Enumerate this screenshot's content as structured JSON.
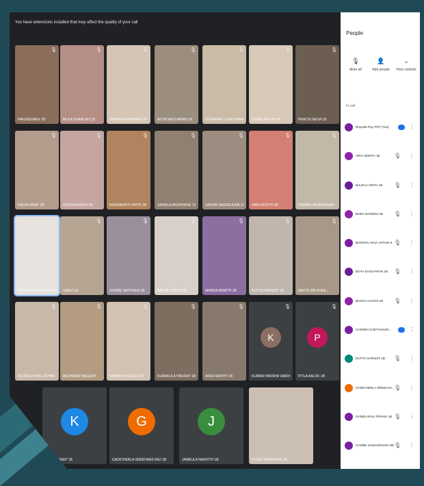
{
  "banner": "You have extensions installed that may affect the quality of your call",
  "panel": {
    "title": "People",
    "actions": [
      {
        "icon": "mute-icon",
        "glyph": "🎙",
        "label": "Mute all"
      },
      {
        "icon": "add-person-icon",
        "glyph": "👤",
        "label": "Add people"
      },
      {
        "icon": "chevron-icon",
        "glyph": "⌄",
        "label": "Host controls"
      }
    ],
    "section": "In call"
  },
  "participants": [
    {
      "name": "Royoole Roy PRT (You)",
      "color": "#7b1fa2",
      "you": true
    },
    {
      "name": "AIRA VEDITH 1B",
      "color": "#8e24aa"
    },
    {
      "name": "BALRAJ VINTH 1B",
      "color": "#6a1b9a"
    },
    {
      "name": "BODA NANDINI 1B",
      "color": "#8e24aa"
    },
    {
      "name": "BOORGU RAVI JATHIN S",
      "color": "#7b1fa2"
    },
    {
      "name": "BOYA SAICHARAN 1B",
      "color": "#6a1b9a"
    },
    {
      "name": "BUSSA AAKSHI 1B",
      "color": "#8e24aa"
    },
    {
      "name": "CHOWKI CHETHAKSR...",
      "color": "#7b1fa2",
      "speaking": true
    },
    {
      "name": "DUTTA HARSHIT 1B",
      "color": "#00897b"
    },
    {
      "name": "GADICHERLA SREEHAS...",
      "color": "#ef6c00"
    },
    {
      "name": "GANDLAPALI PRANIL 1B",
      "color": "#7b1fa2"
    },
    {
      "name": "GANNE HANASRAVAN RE...",
      "color": "#7b1fa2"
    }
  ],
  "tiles": [
    {
      "name": "PANJASHREE 1B",
      "bg": "#8a6d5a"
    },
    {
      "name": "MULA DHANUSH 1B",
      "bg": "#b58f86"
    },
    {
      "name": "SHANMUGANDHAM 1B",
      "bg": "#d4c5b4"
    },
    {
      "name": "BOYA SAICHARAN 1B",
      "bg": "#9c8e7f"
    },
    {
      "name": "KONAPARI LOKESHWAR",
      "bg": "#c9bba6"
    },
    {
      "name": "GUDALA PUJITHA",
      "bg": "#d8c8b8"
    },
    {
      "name": "PRACHI NEHA 1B",
      "bg": "#6d5e52"
    },
    {
      "name": "KALVA VINAY 1B",
      "bg": "#b39c8c"
    },
    {
      "name": "BUSSA AAKSHI 1B",
      "bg": "#c4a5a0"
    },
    {
      "name": "NUDHAVATH VINTH 1B",
      "bg": "#b0845e"
    },
    {
      "name": "GANDLA ANUPRANIL 1B",
      "bg": "#8f8070"
    },
    {
      "name": "GADAM NAGARJUNA 1B",
      "bg": "#9d8d80"
    },
    {
      "name": "AIRA VEDITH 1B",
      "bg": "#d47f73"
    },
    {
      "name": "GANNE HANASRAVAN",
      "bg": "#c2b8a8"
    },
    {
      "name": "CHOWKI CHETHAKSR 1B",
      "bg": "#e6e2de",
      "active": true
    },
    {
      "name": "SANVI 1B",
      "bg": "#b5a592"
    },
    {
      "name": "GORRE SATHVIKA 1B",
      "bg": "#9b8f9e"
    },
    {
      "name": "BALRAJ VINTH 1B",
      "bg": "#d8d0c8"
    },
    {
      "name": "MANDA MANITH 1B",
      "bg": "#8b6fa0"
    },
    {
      "name": "DUTTA HARSHIT 1B",
      "bg": "#c0b6ad"
    },
    {
      "name": "NAVYA SRI AUKA...",
      "bg": "#a89888"
    },
    {
      "name": "BOORGU RAVI JATHIN",
      "bg": "#c8b8a8"
    },
    {
      "name": "MESHRAM NAGESH",
      "bg": "#b39c82"
    },
    {
      "name": "BADAM VASUDEV 1B",
      "bg": "#d2c2b2"
    },
    {
      "name": "KURAKULA HRUDAY 1B",
      "bg": "#7e6e60"
    },
    {
      "name": "ARVA SAHITH 1B",
      "bg": "#877a6d"
    },
    {
      "name": "KURMA HARSHA VARDHA...",
      "bg": "#3c4043",
      "letter": "K",
      "avatar": "#8d6e63"
    },
    {
      "name": "PITLA AALOK 1B",
      "bg": "#3c4043",
      "letter": "P",
      "avatar": "#c2185b"
    }
  ],
  "bottom_tiles": [
    {
      "name": "KONDA DEEP 1B",
      "letter": "K",
      "avatar": "#1e88e5"
    },
    {
      "name": "GADICHERLA SREEHAAS RAJ 1B",
      "letter": "G",
      "avatar": "#ef6c00"
    },
    {
      "name": "JAMKULA NANVITH 1B",
      "letter": "J",
      "avatar": "#388e3c"
    },
    {
      "name": "POORI SHARANYA 1B",
      "bg": "#cbbfb4"
    }
  ]
}
